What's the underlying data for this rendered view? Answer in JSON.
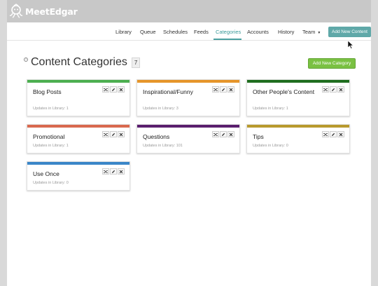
{
  "brand": {
    "name": "MeetEdgar"
  },
  "nav": {
    "items": [
      {
        "label": "Library"
      },
      {
        "label": "Queue"
      },
      {
        "label": "Schedules"
      },
      {
        "label": "Feeds"
      },
      {
        "label": "Categories"
      },
      {
        "label": "Accounts"
      },
      {
        "label": "History"
      },
      {
        "label": "Team"
      }
    ],
    "active": "Categories",
    "add_content_label": "Add New Content"
  },
  "page": {
    "title": "Content Categories",
    "count": "7",
    "add_category_label": "Add New Category"
  },
  "categories": [
    {
      "name": "Blog Posts",
      "updates": "Updates in Library: 1",
      "color": "#4caf50"
    },
    {
      "name": "Inspirational/Funny",
      "updates": "Updates in Library: 3",
      "color": "#e6952a"
    },
    {
      "name": "Other People's Content",
      "updates": "Updates in Library: 1",
      "color": "#1f6e1f"
    },
    {
      "name": "Promotional",
      "updates": "Updates in Library: 1",
      "color": "#d9694f"
    },
    {
      "name": "Questions",
      "updates": "Updates in Library: 101",
      "color": "#5a1e6e"
    },
    {
      "name": "Tips",
      "updates": "Updates in Library: 0",
      "color": "#b89a2e"
    },
    {
      "name": "Use Once",
      "updates": "Updates in Library: 0",
      "color": "#3a86c8"
    }
  ],
  "icons": {
    "shuffle": "shuffle-icon",
    "edit": "pencil-icon",
    "delete": "close-icon"
  }
}
